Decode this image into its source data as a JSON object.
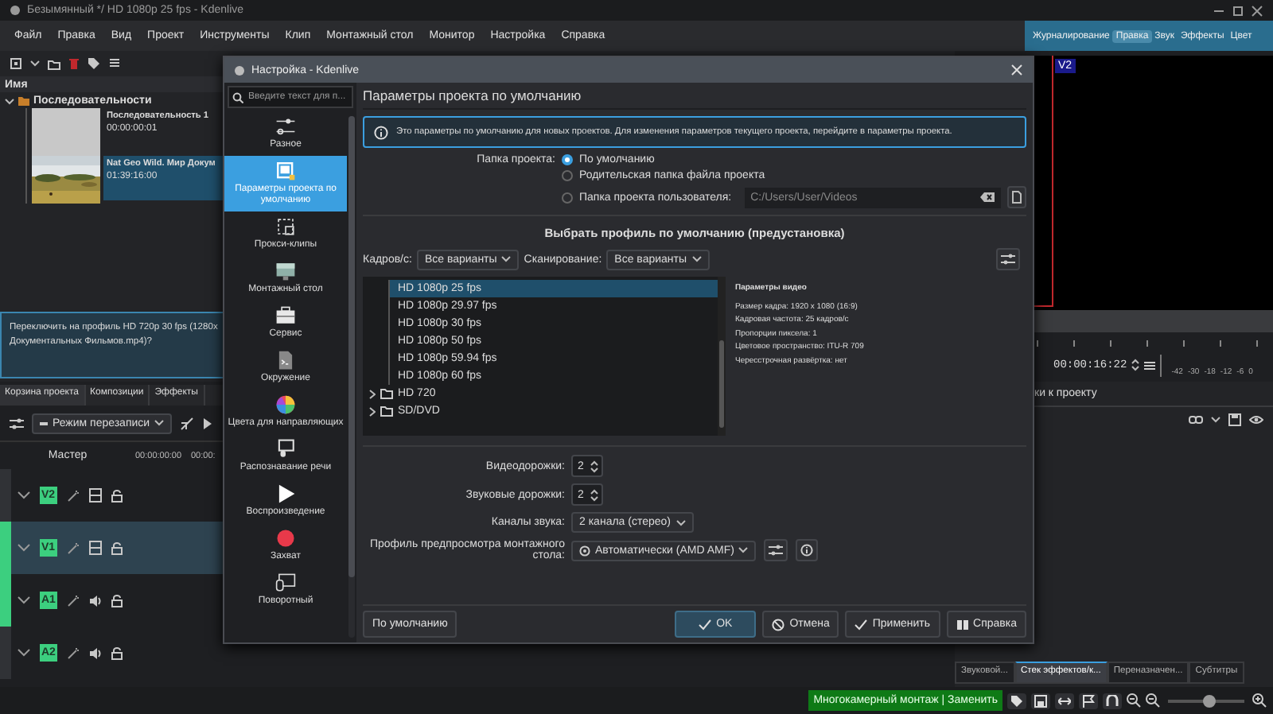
{
  "window": {
    "title": "Безымянный */ HD 1080p 25 fps - Kdenlive"
  },
  "menu": [
    "Файл",
    "Правка",
    "Вид",
    "Проект",
    "Инструменты",
    "Клип",
    "Монтажный стол",
    "Монитор",
    "Настройка",
    "Справка"
  ],
  "workspaces": [
    {
      "label": "Журналирование",
      "selected": false
    },
    {
      "label": "Правка",
      "selected": true
    },
    {
      "label": "Звук",
      "selected": false
    },
    {
      "label": "Эффекты",
      "selected": false
    },
    {
      "label": "Цвет",
      "selected": false
    }
  ],
  "bin": {
    "header": "Имя",
    "folder": "Последовательности",
    "clips": [
      {
        "name": "Последовательность 1",
        "duration": "00:00:00:01",
        "kind": "blank",
        "selected": false
      },
      {
        "name": "Nat Geo Wild. Мир Докум",
        "duration": "01:39:16:00",
        "kind": "picture",
        "selected": true
      }
    ],
    "message": [
      "Переключить на профиль HD 720p 30 fps (1280x",
      "Документальных Фильмов.mp4)?"
    ]
  },
  "panel_tabs": [
    {
      "label": "Корзина проекта",
      "selected": true
    },
    {
      "label": "Композиции",
      "selected": false
    },
    {
      "label": "Эффекты",
      "selected": false
    }
  ],
  "timeline": {
    "mode": "Режим перезаписи",
    "master": "Мастер",
    "ruler": [
      "00:00:00:00",
      "00:00:"
    ],
    "tracks": [
      {
        "name": "V2",
        "kind": "video",
        "selected": false,
        "targeted": false
      },
      {
        "name": "V1",
        "kind": "video",
        "selected": true,
        "targeted": true
      },
      {
        "name": "A1",
        "kind": "audio",
        "selected": false,
        "targeted": true
      },
      {
        "name": "A2",
        "kind": "audio",
        "selected": false,
        "targeted": false
      }
    ]
  },
  "monitor": {
    "track": "V2",
    "timecode": "00:00:16:22",
    "meter_labels": [
      "-42",
      "-30",
      "-18",
      "-12",
      "-6",
      "0"
    ],
    "tab_fragment": "ки к проекту"
  },
  "bottom_tabs": [
    {
      "label": "Звуковой...",
      "selected": false
    },
    {
      "label": "Стек эффектов/к...",
      "selected": true
    },
    {
      "label": "Переназначен...",
      "selected": false
    },
    {
      "label": "Субтитры",
      "selected": false
    }
  ],
  "status_bar": {
    "mode": "Многокамерный монтаж | Заменить",
    "zoom": {
      "level": 0.55
    }
  },
  "dialog": {
    "title": "Настройка - Kdenlive",
    "search": {
      "placeholder": "Введите текст для п..."
    },
    "pages": [
      {
        "label": "Разное",
        "selected": false
      },
      {
        "label": "Параметры проекта по умолчанию",
        "selected": true
      },
      {
        "label": "Прокси-клипы",
        "selected": false
      },
      {
        "label": "Монтажный стол",
        "selected": false
      },
      {
        "label": "Сервис",
        "selected": false
      },
      {
        "label": "Окружение",
        "selected": false
      },
      {
        "label": "Цвета для направляющих",
        "selected": false
      },
      {
        "label": "Распознавание речи",
        "selected": false
      },
      {
        "label": "Воспроизведение",
        "selected": false
      },
      {
        "label": "Захват",
        "selected": false
      },
      {
        "label": "Поворотный",
        "selected": false
      }
    ],
    "page_title": "Параметры проекта по умолчанию",
    "info": "Это параметры по умолчанию для новых проектов. Для изменения параметров текущего проекта, перейдите в параметры проекта.",
    "folder": {
      "label": "Папка проекта:",
      "options": [
        {
          "label": "По умолчанию",
          "selected": true
        },
        {
          "label": "Родительская папка файла проекта",
          "selected": false
        },
        {
          "label": "Папка проекта пользователя:",
          "selected": false
        }
      ],
      "path": "C:/Users/User/Videos"
    },
    "profile": {
      "heading": "Выбрать профиль по умолчанию (предустановка)",
      "fps_label": "Кадров/с:",
      "fps": "Все варианты",
      "scan_label": "Сканирование:",
      "scan": "Все варианты",
      "items": [
        {
          "label": "HD 1080p 25 fps",
          "kind": "profile",
          "selected": true
        },
        {
          "label": "HD 1080p 29.97 fps",
          "kind": "profile",
          "selected": false
        },
        {
          "label": "HD 1080p 30 fps",
          "kind": "profile",
          "selected": false
        },
        {
          "label": "HD 1080p 50 fps",
          "kind": "profile",
          "selected": false
        },
        {
          "label": "HD 1080p 59.94 fps",
          "kind": "profile",
          "selected": false
        },
        {
          "label": "HD 1080p 60 fps",
          "kind": "profile",
          "selected": false
        },
        {
          "label": "HD 720",
          "kind": "folder",
          "selected": false
        },
        {
          "label": "SD/DVD",
          "kind": "folder",
          "selected": false
        }
      ],
      "details_title": "Параметры видео",
      "details": [
        "Размер кадра: 1920 x 1080 (16:9)",
        "Кадровая частота: 25 кадров/с",
        "Пропорции пиксела: 1",
        "Цветовое пространство: ITU-R 709",
        "Чересстрочная развёртка: нет"
      ]
    },
    "fields": [
      {
        "label": "Видеодорожки:",
        "value": "2",
        "kind": "spin"
      },
      {
        "label": "Звуковые дорожки:",
        "value": "2",
        "kind": "spin"
      },
      {
        "label": "Каналы звука:",
        "value": "2 канала (стерео)",
        "kind": "combo"
      },
      {
        "label": "Профиль предпросмотра монтажного стола:",
        "value": "Автоматически (AMD AMF)",
        "kind": "combo_tools"
      }
    ],
    "buttons": [
      {
        "label": "По умолчанию",
        "kind": "plain"
      },
      {
        "label": "OK",
        "kind": "default"
      },
      {
        "label": "Отмена",
        "kind": "cancel"
      },
      {
        "label": "Применить",
        "kind": "apply"
      },
      {
        "label": "Справка",
        "kind": "help"
      }
    ]
  }
}
